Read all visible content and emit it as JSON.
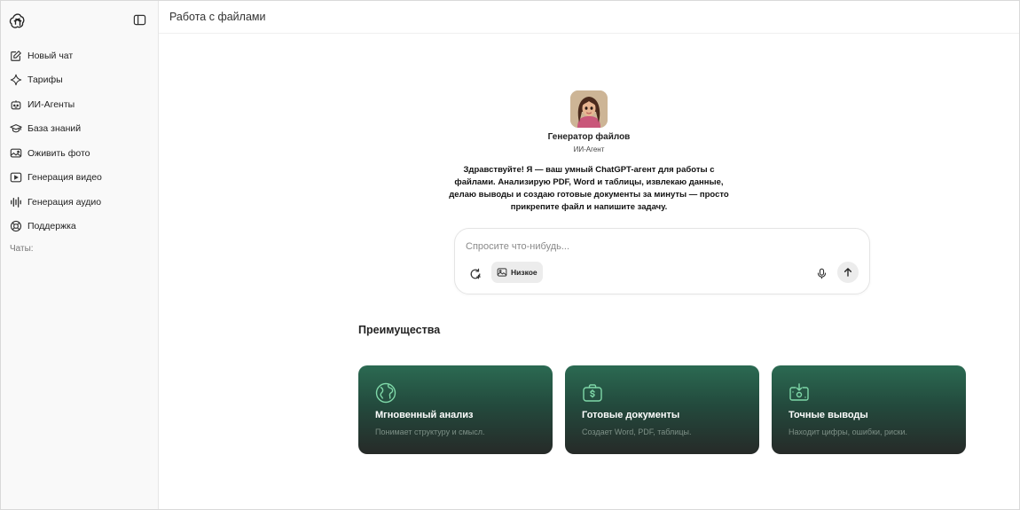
{
  "sidebar": {
    "items": [
      {
        "label": "Новый чат",
        "icon": "edit-icon"
      },
      {
        "label": "Тарифы",
        "icon": "sparkle-icon"
      },
      {
        "label": "ИИ-Агенты",
        "icon": "robot-icon"
      },
      {
        "label": "База знаний",
        "icon": "graduation-cap-icon"
      },
      {
        "label": "Оживить фото",
        "icon": "photo-animate-icon"
      },
      {
        "label": "Генерация видео",
        "icon": "video-icon"
      },
      {
        "label": "Генерация аудио",
        "icon": "audio-wave-icon"
      },
      {
        "label": "Поддержка",
        "icon": "support-icon"
      }
    ],
    "chats_label": "Чаты:"
  },
  "header": {
    "title": "Работа с файлами"
  },
  "agent": {
    "name": "Генератор файлов",
    "subtitle": "ИИ-Агент",
    "greeting": "Здравствуйте! Я — ваш умный ChatGPT-агент для работы с файлами. Анализирую PDF, Word и таблицы, извлекаю данные, делаю выводы и создаю готовые документы за минуты — просто прикрепите файл и напишите задачу."
  },
  "composer": {
    "placeholder": "Спросите что-нибудь...",
    "quality_label": "Низкое"
  },
  "advantages": {
    "title": "Преимущества",
    "cards": [
      {
        "title": "Мгновенный анализ",
        "subtitle": "Понимает структуру и смысл.",
        "icon": "globe-icon"
      },
      {
        "title": "Готовые документы",
        "subtitle": "Создает Word, PDF, таблицы.",
        "icon": "briefcase-dollar-icon"
      },
      {
        "title": "Точные выводы",
        "subtitle": "Находит цифры, ошибки, риски.",
        "icon": "money-download-icon"
      }
    ]
  },
  "colors": {
    "card_top": "#2b6a52",
    "card_bottom": "#262a28",
    "sidebar_bg": "#f9f9f9"
  }
}
